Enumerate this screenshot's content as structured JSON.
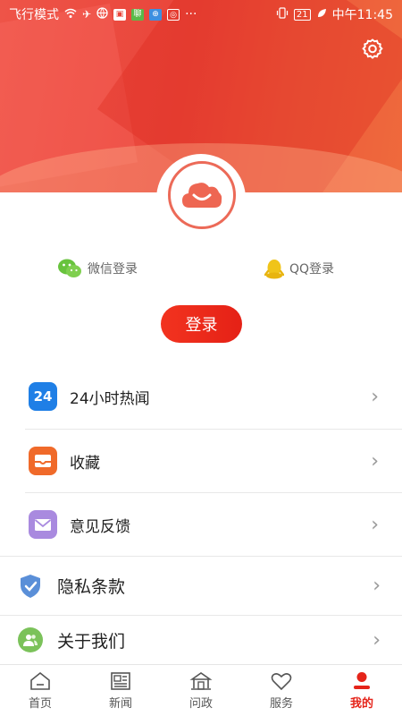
{
  "status_bar": {
    "airplane_mode": "飞行模式",
    "time": "中午11:45",
    "battery": "21",
    "dots": "···"
  },
  "header": {
    "settings_icon": "gear-icon",
    "avatar_icon": "cloud-smile-icon"
  },
  "login": {
    "wechat_label": "微信登录",
    "qq_label": "QQ登录",
    "button_label": "登录"
  },
  "menu": {
    "items": [
      {
        "label": "24小时热闻",
        "icon": "24h-news-icon",
        "icon_text": "24",
        "color": "#1f7fe6"
      },
      {
        "label": "收藏",
        "icon": "favorite-box-icon",
        "color": "#f06a2a"
      },
      {
        "label": "意见反馈",
        "icon": "mail-icon",
        "color": "#a98adf"
      },
      {
        "label": "隐私条款",
        "icon": "shield-check-icon",
        "color": "#5a8fd8"
      },
      {
        "label": "关于我们",
        "icon": "users-icon",
        "color": "#7bc25a"
      }
    ],
    "chevron": "›"
  },
  "tabbar": {
    "tabs": [
      {
        "label": "首页",
        "icon": "home-icon",
        "active": false
      },
      {
        "label": "新闻",
        "icon": "newspaper-icon",
        "active": false
      },
      {
        "label": "问政",
        "icon": "government-building-icon",
        "active": false
      },
      {
        "label": "服务",
        "icon": "heart-icon",
        "active": false
      },
      {
        "label": "我的",
        "icon": "user-icon",
        "active": true
      }
    ]
  },
  "colors": {
    "brand_red": "#e5241a",
    "header_red": "#e9453a"
  }
}
